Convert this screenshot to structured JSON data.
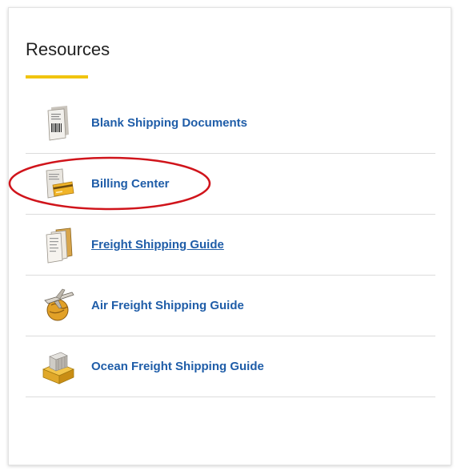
{
  "panel": {
    "title": "Resources",
    "accent_color": "#f1c40f",
    "link_color": "#1f5da8",
    "highlight_color": "#d0141b"
  },
  "resources": [
    {
      "label": "Blank Shipping Documents",
      "icon": "document-barcode-icon"
    },
    {
      "label": "Billing Center",
      "icon": "credit-card-invoice-icon"
    },
    {
      "label": "Freight Shipping Guide",
      "icon": "document-stack-icon"
    },
    {
      "label": "Air Freight Shipping Guide",
      "icon": "airplane-globe-icon"
    },
    {
      "label": "Ocean Freight Shipping Guide",
      "icon": "cargo-container-icon"
    }
  ]
}
